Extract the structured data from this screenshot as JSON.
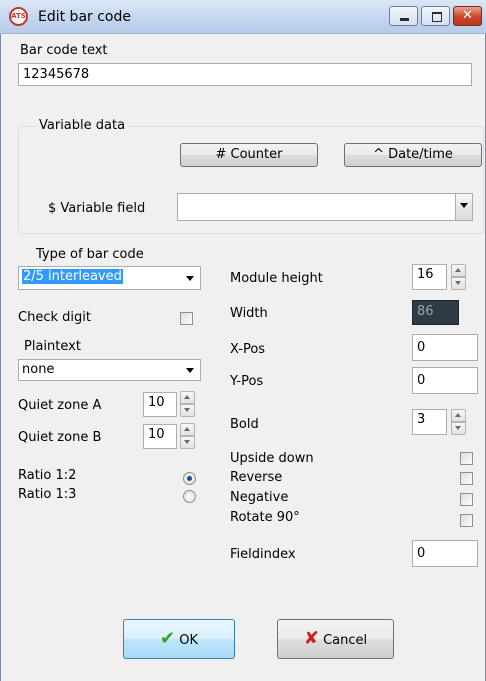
{
  "window": {
    "title": "Edit bar code",
    "app_icon_text": "ATS"
  },
  "barcode_text": {
    "label": "Bar code text",
    "value": "12345678"
  },
  "variable_data": {
    "title": "Variable data",
    "counter_button": "# Counter",
    "datetime_button": "^ Date/time",
    "variable_field_label": "$ Variable field",
    "variable_field_value": ""
  },
  "left": {
    "type_label": "Type of bar code",
    "type_value": "2/5 interleaved",
    "check_digit_label": "Check digit",
    "check_digit_checked": false,
    "plaintext_label": "Plaintext",
    "plaintext_value": "none",
    "quiet_zone_a_label": "Quiet zone A",
    "quiet_zone_a_value": "10",
    "quiet_zone_b_label": "Quiet zone B",
    "quiet_zone_b_value": "10",
    "ratio_1_2_label": "Ratio 1:2",
    "ratio_1_3_label": "Ratio 1:3",
    "ratio_selected": "1:2"
  },
  "right": {
    "module_height_label": "Module height",
    "module_height_value": "16",
    "width_label": "Width",
    "width_value": "86",
    "xpos_label": "X-Pos",
    "xpos_value": "0",
    "ypos_label": "Y-Pos",
    "ypos_value": "0",
    "bold_label": "Bold",
    "bold_value": "3",
    "upside_down_label": "Upside down",
    "reverse_label": "Reverse",
    "negative_label": "Negative",
    "rotate_label": "Rotate 90°",
    "fieldindex_label": "Fieldindex",
    "fieldindex_value": "0"
  },
  "footer": {
    "ok_label": "OK",
    "cancel_label": "Cancel"
  },
  "colors": {
    "accent_selection": "#3399ff",
    "width_field_bg": "#2f3a44",
    "ok_check": "#3a9e1f",
    "cancel_x": "#c8231b"
  }
}
